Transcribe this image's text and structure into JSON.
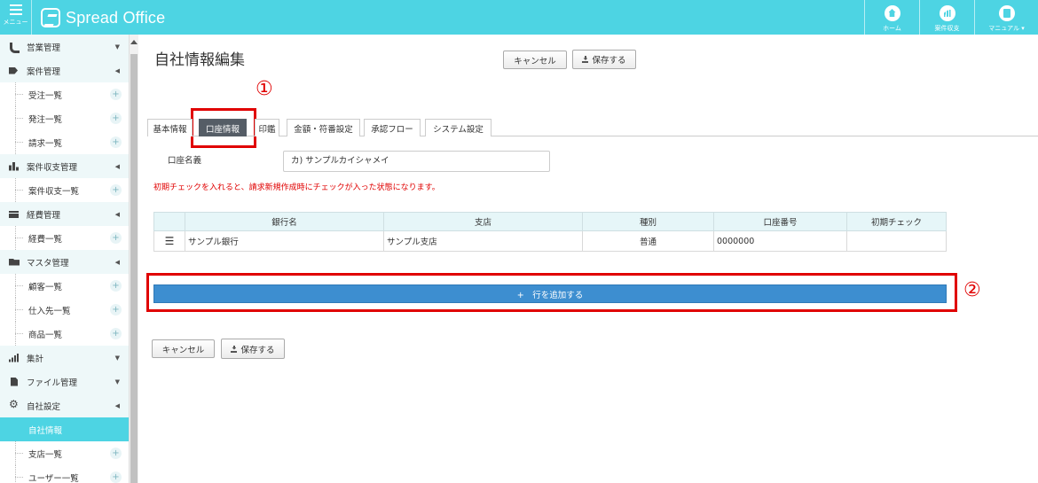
{
  "app": {
    "menu_label": "メニュー",
    "logo_text": "Spread Office",
    "nav": [
      {
        "label": "ホーム",
        "icon": "home-icon"
      },
      {
        "label": "案件収支",
        "icon": "bar-chart-icon"
      },
      {
        "label": "マニュアル ▾",
        "icon": "book-icon"
      }
    ]
  },
  "sidebar": {
    "items": [
      {
        "type": "group",
        "label": "営業管理",
        "icon": "phone-icon",
        "arrow": "▼"
      },
      {
        "type": "group",
        "label": "案件管理",
        "icon": "tag-icon",
        "arrow": "◀"
      },
      {
        "type": "child",
        "label": "受注一覧",
        "plus": "+"
      },
      {
        "type": "child",
        "label": "発注一覧",
        "plus": "+"
      },
      {
        "type": "child",
        "label": "請求一覧",
        "plus": "+"
      },
      {
        "type": "group",
        "label": "案件収支管理",
        "icon": "bar-chart-icon",
        "arrow": "◀"
      },
      {
        "type": "child",
        "label": "案件収支一覧",
        "plus": "+"
      },
      {
        "type": "group",
        "label": "経費管理",
        "icon": "card-icon",
        "arrow": "◀"
      },
      {
        "type": "child",
        "label": "経費一覧",
        "plus": "+"
      },
      {
        "type": "group",
        "label": "マスタ管理",
        "icon": "folder-icon",
        "arrow": "◀"
      },
      {
        "type": "child",
        "label": "顧客一覧",
        "plus": "+"
      },
      {
        "type": "child",
        "label": "仕入先一覧",
        "plus": "+"
      },
      {
        "type": "child",
        "label": "商品一覧",
        "plus": "+"
      },
      {
        "type": "group",
        "label": "集計",
        "icon": "graph-icon",
        "arrow": "▼"
      },
      {
        "type": "group",
        "label": "ファイル管理",
        "icon": "file-icon",
        "arrow": "▼"
      },
      {
        "type": "group",
        "label": "自社設定",
        "icon": "gear-icon",
        "arrow": "◀"
      },
      {
        "type": "active",
        "label": "自社情報"
      },
      {
        "type": "child",
        "label": "支店一覧",
        "plus": "+"
      },
      {
        "type": "child",
        "label": "ユーザー一覧",
        "plus": "+"
      }
    ]
  },
  "main": {
    "title": "自社情報編集",
    "cancel_label": "キャンセル",
    "save_label": "保存する",
    "annotation_1": "①",
    "annotation_2": "②",
    "tabs": [
      "基本情報",
      "口座情報",
      "印鑑",
      "金額・符番設定",
      "承認フロー",
      "システム設定"
    ],
    "active_tab": "口座情報",
    "account_name_label": "口座名義",
    "account_name_value": "カ) サンプルカイシャメイ",
    "notice": "初期チェックを入れると、請求新規作成時にチェックが入った状態になります。",
    "table": {
      "columns": [
        "",
        "銀行名",
        "支店",
        "種別",
        "口座番号",
        "初期チェック"
      ],
      "rows": [
        {
          "handle": "☰",
          "bank": "サンプル銀行",
          "branch": "サンプル支店",
          "type": "普通",
          "number": "0000000",
          "check": ""
        }
      ]
    },
    "add_row_label": "+　行を追加する"
  },
  "colors": {
    "topbar": "#4dd4e3",
    "sidebar_active": "#4dd4e3",
    "add_row": "#3d8ed0",
    "annotation": "#e00000",
    "active_tab": "#555d66"
  }
}
